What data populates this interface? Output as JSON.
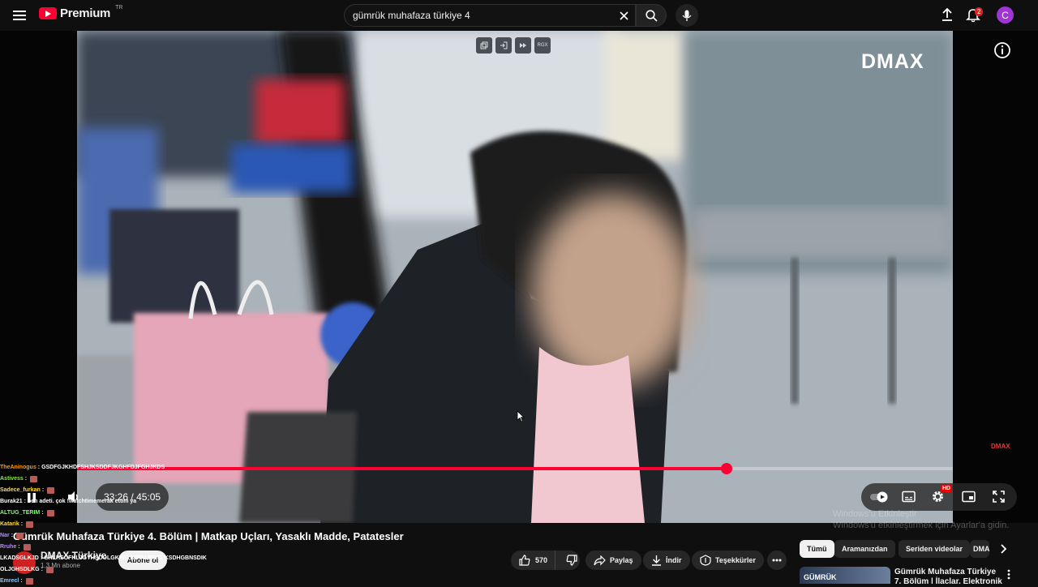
{
  "topbar": {
    "menu_icon": "hamburger-menu-icon",
    "logo_text": "Premium",
    "logo_region": "TR",
    "search_value": "gümrük muhafaza türkiye 4",
    "notification_count": "2",
    "avatar_letter": "C",
    "avatar_color": "#a034d6"
  },
  "player": {
    "channel_watermark": "DMAX",
    "channel_watermark_small": "DMAX",
    "overlay_buttons": [
      "",
      "",
      "",
      "RGX"
    ],
    "time_current": "33:26",
    "time_total": "45:05",
    "time_separator": "/",
    "progress_fraction": 0.7417,
    "hd_badge": "HD",
    "accent_color": "#ff0033"
  },
  "windows_watermark": {
    "line1": "Windows'u Etkinleştir",
    "line2": "Windows'u etkinleştirmek için Ayarlar'a gidin."
  },
  "chat": [
    {
      "name": "TheAninogus",
      "color": "#ff9900",
      "msg": "GSDFGJKHDFSHJKSDDFJKGHFDJFGHJKDS"
    },
    {
      "name": "Astivess",
      "color": "#8be84b",
      "msg": ""
    },
    {
      "name": "Sadece_furkan",
      "color": "#ffd93b",
      "msg": ""
    },
    {
      "name": "Burak21",
      "color": "#ffffff",
      "msg": "ben adeti. çok !watchtimemerak ettim ya"
    },
    {
      "name": "ALTUG_TERIM",
      "color": "#7cff6b",
      "msg": ""
    },
    {
      "name": "Katarik",
      "color": "#ffd93b",
      "msg": ""
    },
    {
      "name": "Nar",
      "color": "#b48bff",
      "msg": ""
    },
    {
      "name": "Rruhe",
      "color": "#b48bff",
      "msg": ""
    },
    {
      "name": "LKADSGLKJD",
      "color": "#ffffff",
      "msg": "GKLHSOFKLJGYHSDOLGKHSLKDTUJFGSLKSDHGBNSDIK"
    },
    {
      "name": "OLJGHSDLKG",
      "color": "#ffffff",
      "msg": ""
    },
    {
      "name": "Emrecl",
      "color": "#8ec8ff",
      "msg": ""
    }
  ],
  "video": {
    "title": "Gümrük Muhafaza Türkiye 4. Bölüm | Matkap Uçları, Yasaklı Madde, Patatesler",
    "channel": "DMAX Türkiye",
    "subscribers": "1,3 Mn abone",
    "subscribe_label": "Abone ol",
    "likes": "570",
    "share_label": "Paylaş",
    "download_label": "İndir",
    "thanks_label": "Teşekkürler"
  },
  "recommendations": {
    "chips": [
      "Tümü",
      "Aramanızdan",
      "Seriden videolar",
      "DMAX"
    ],
    "first_thumb_text": "GÜMRÜK",
    "first_title": "Gümrük Muhafaza Türkiye 7. Bölüm | İlaçlar, Elektronik"
  }
}
